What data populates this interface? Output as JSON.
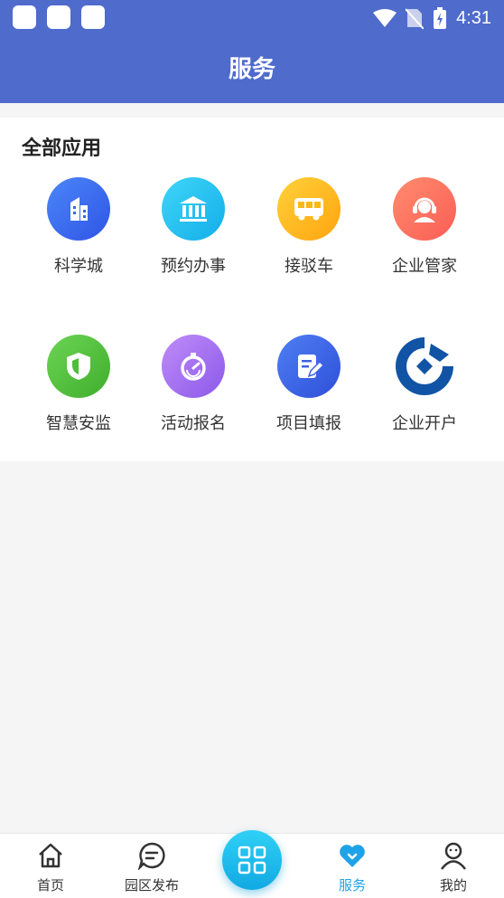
{
  "status": {
    "time": "4:31"
  },
  "header": {
    "title": "服务"
  },
  "section": {
    "title": "全部应用"
  },
  "apps": [
    {
      "label": "科学城",
      "icon": "building-icon",
      "color": "#3e6cf0"
    },
    {
      "label": "预约办事",
      "icon": "bank-icon",
      "color": "#22c0f0"
    },
    {
      "label": "接驳车",
      "icon": "bus-icon",
      "color": "#ffb619"
    },
    {
      "label": "企业管家",
      "icon": "customer-service-icon",
      "color": "#ff6f61"
    },
    {
      "label": "智慧安监",
      "icon": "shield-icon",
      "color": "#4ebd3a"
    },
    {
      "label": "活动报名",
      "icon": "stopwatch-icon",
      "color": "#a36bef"
    },
    {
      "label": "项目填报",
      "icon": "edit-form-icon",
      "color": "#3e61e6"
    },
    {
      "label": "企业开户",
      "icon": "ccb-logo-icon",
      "color": "#1154a6"
    }
  ],
  "tabs": [
    {
      "label": "首页",
      "icon": "home-icon"
    },
    {
      "label": "园区发布",
      "icon": "message-icon"
    },
    {
      "label": "服务",
      "icon": "heart-icon",
      "active": true
    },
    {
      "label": "我的",
      "icon": "user-icon"
    }
  ],
  "colors": {
    "header": "#4f6bcc",
    "active_tab": "#1fa3e8",
    "scan_button": "#1cb9ea"
  }
}
